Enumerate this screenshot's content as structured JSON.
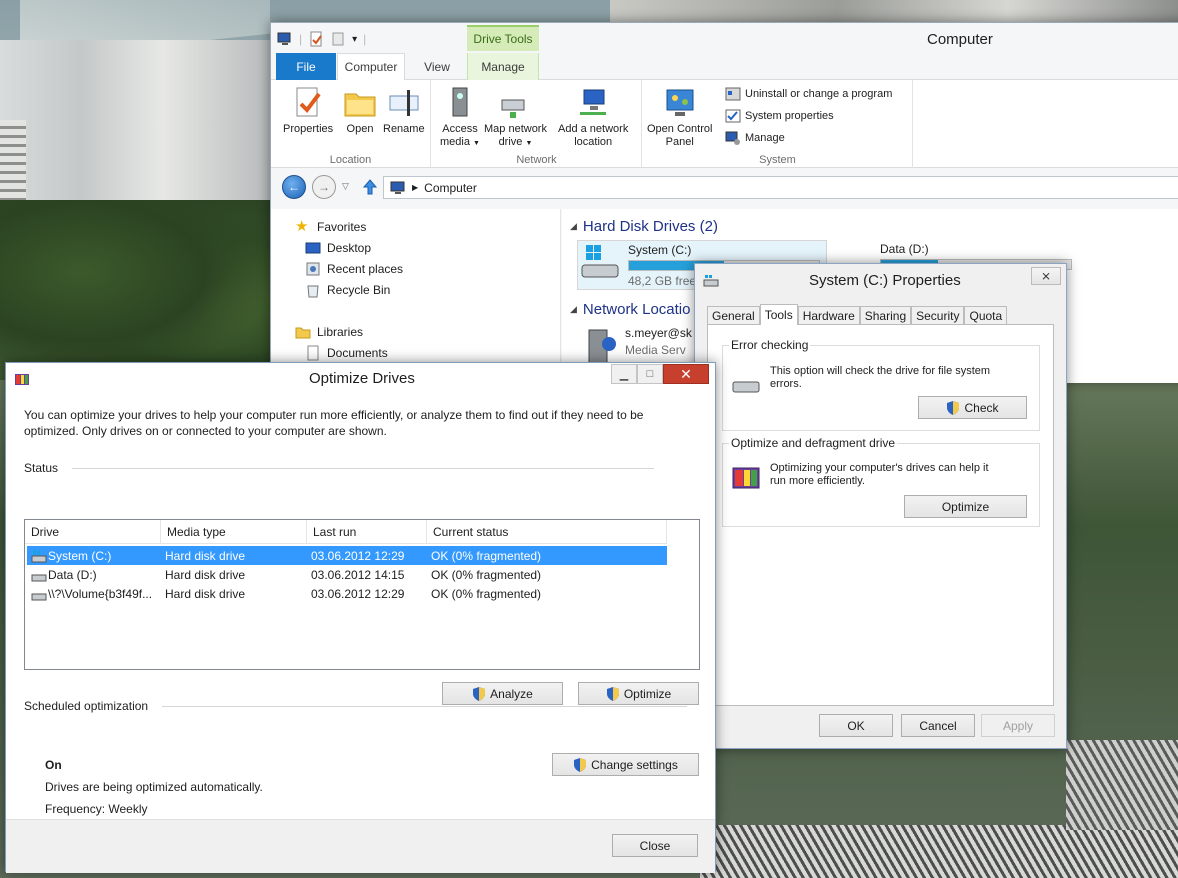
{
  "explorer": {
    "title": "Computer",
    "context_tab_group": "Drive Tools",
    "tabs": {
      "file": "File",
      "computer": "Computer",
      "view": "View",
      "manage": "Manage"
    },
    "ribbon": {
      "location": {
        "label": "Location",
        "properties": "Properties",
        "open": "Open",
        "rename": "Rename"
      },
      "network": {
        "label": "Network",
        "access_media_1": "Access",
        "access_media_2": "media",
        "map_drive_1": "Map network",
        "map_drive_2": "drive",
        "add_location_1": "Add a network",
        "add_location_2": "location"
      },
      "system": {
        "label": "System",
        "open_cp_1": "Open Control",
        "open_cp_2": "Panel",
        "uninstall": "Uninstall or change a program",
        "system_properties": "System properties",
        "manage": "Manage"
      }
    },
    "address": {
      "path": "Computer"
    },
    "nav": {
      "favorites": "Favorites",
      "desktop": "Desktop",
      "recent_places": "Recent places",
      "recycle_bin": "Recycle Bin",
      "libraries": "Libraries",
      "documents": "Documents"
    },
    "content": {
      "hard_disk_header": "Hard Disk Drives (2)",
      "network_header": "Network Locatio",
      "drive_c": {
        "name": "System (C:)",
        "free": "48,2 GB free",
        "fill": 0.5
      },
      "drive_d": {
        "name": "Data (D:)",
        "fill": 0.3
      },
      "net_item": {
        "name": "s.meyer@sk",
        "type": "Media Serv"
      }
    }
  },
  "props": {
    "title": "System (C:) Properties",
    "close": "⨯",
    "tabs": [
      "General",
      "Tools",
      "Hardware",
      "Sharing",
      "Security",
      "Quota"
    ],
    "error_checking": {
      "title": "Error checking",
      "text": "This option will check the drive for file system errors.",
      "button": "Check"
    },
    "optimize": {
      "title": "Optimize and defragment drive",
      "text": "Optimizing your computer's drives can help it run more efficiently.",
      "button": "Optimize"
    },
    "buttons": {
      "ok": "OK",
      "cancel": "Cancel",
      "apply": "Apply"
    }
  },
  "optimize": {
    "title": "Optimize Drives",
    "description": "You can optimize your drives to help your computer run more efficiently, or analyze them to find out if they need to be optimized. Only drives on or connected to your computer are shown.",
    "status_label": "Status",
    "columns": [
      "Drive",
      "Media type",
      "Last run",
      "Current status"
    ],
    "rows": [
      {
        "drive": "System (C:)",
        "media": "Hard disk drive",
        "last_run": "03.06.2012 12:29",
        "status": "OK (0% fragmented)"
      },
      {
        "drive": "Data (D:)",
        "media": "Hard disk drive",
        "last_run": "03.06.2012 14:15",
        "status": "OK (0% fragmented)"
      },
      {
        "drive": "\\\\?\\Volume{b3f49f...",
        "media": "Hard disk drive",
        "last_run": "03.06.2012 12:29",
        "status": "OK (0% fragmented)"
      }
    ],
    "analyze": "Analyze",
    "optimize": "Optimize",
    "scheduled_label": "Scheduled optimization",
    "change_settings": "Change settings",
    "schedule_state": "On",
    "schedule_desc": "Drives are being optimized automatically.",
    "frequency": "Frequency: Weekly",
    "close": "Close"
  }
}
